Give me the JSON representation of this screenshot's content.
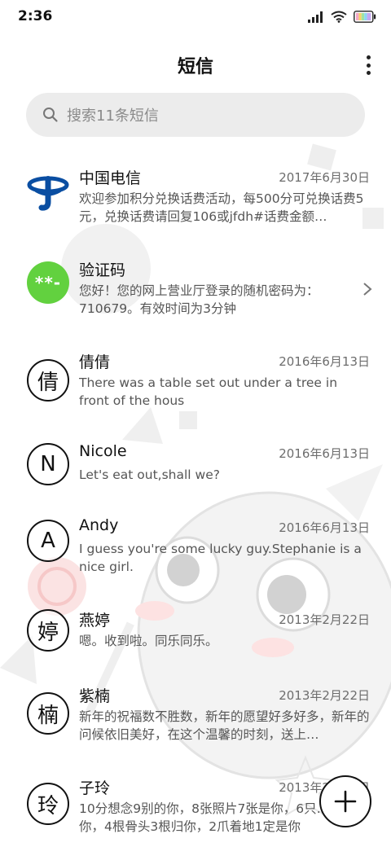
{
  "status_bar": {
    "time": "2:36"
  },
  "header": {
    "title": "短信"
  },
  "search": {
    "placeholder": "搜索11条短信"
  },
  "conversations": [
    {
      "name": "中国电信",
      "date": "2017年6月30日",
      "preview": "欢迎参加积分兑换话费活动，每500分可兑换话费5元，兑换话费请回复106或jfdh#话费金额…",
      "avatar_type": "logo"
    },
    {
      "name": "验证码",
      "date": "",
      "preview": "您好！您的网上营业厅登录的随机密码为：710679。有效时间为3分钟",
      "avatar_text": "**-",
      "avatar_type": "green"
    },
    {
      "name": "倩倩",
      "date": "2016年6月13日",
      "preview": "There was a table set out under a tree in front of the hous",
      "avatar_text": "倩",
      "avatar_type": "ring"
    },
    {
      "name": "Nicole",
      "date": "2016年6月13日",
      "preview": "Let's eat out,shall we?",
      "avatar_text": "N",
      "avatar_type": "ring"
    },
    {
      "name": "Andy",
      "date": "2016年6月13日",
      "preview": "I guess you're some lucky guy.Stephanie is a nice girl.",
      "avatar_text": "A",
      "avatar_type": "ring"
    },
    {
      "name": "燕婷",
      "date": "2013年2月22日",
      "preview": "嗯。收到啦。同乐同乐。",
      "avatar_text": "婷",
      "avatar_type": "ring"
    },
    {
      "name": "紫楠",
      "date": "2013年2月22日",
      "preview": "新年的祝福数不胜数，新年的愿望好多好多，新年的问候依旧美好，在这个温馨的时刻，送上…",
      "avatar_text": "楠",
      "avatar_type": "ring"
    },
    {
      "name": "子玲",
      "date": "2013年2月22日",
      "preview": "10分想念9别的你，8张照片7张是你，6只…只像你，4根骨头3根归你，2爪着地1定是你",
      "avatar_text": "玲",
      "avatar_type": "ring"
    }
  ],
  "colors": {
    "accent_green": "#62d13f",
    "telecom_blue": "#0a4ea2",
    "search_bg": "#ececec"
  },
  "icons": {
    "search": "search-icon",
    "menu": "more-vertical-icon",
    "chevron": "chevron-right-icon",
    "compose": "plus-icon",
    "telecom": "china-telecom-logo"
  }
}
